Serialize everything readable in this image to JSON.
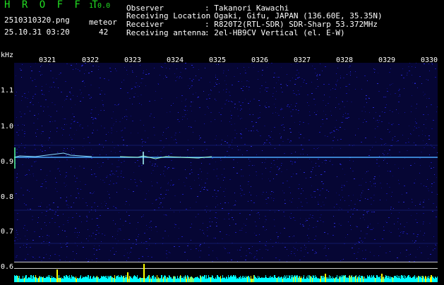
{
  "header": {
    "logo": "H R O F F T",
    "version": "1.0.0",
    "filename": "2510310320.png",
    "datetime": "25.10.31 03:20",
    "meteor_label": "meteor",
    "meteor_count": "42"
  },
  "info": {
    "observer_label": "Observer",
    "observer_value": ": Takanori Kawachi",
    "location_label": "Receiving Location",
    "location_value": ": Ogaki, Gifu, JAPAN (136.60E, 35.35N)",
    "receiver_label": "Receiver",
    "receiver_value": ": R820T2(RTL-SDR) SDR-Sharp 53.372MHz",
    "antenna_label": "Receiving antenna",
    "antenna_value": ": 2el-HB9CV Vertical (el. E-W)"
  },
  "axis": {
    "y_unit": "kHz",
    "time_ticks": [
      "0321",
      "0322",
      "0323",
      "0324",
      "0325",
      "0326",
      "0327",
      "0328",
      "0329",
      "0330"
    ],
    "freq_ticks": [
      "1.1",
      "1.0",
      "0.9",
      "0.8",
      "0.7",
      "0.6"
    ]
  },
  "colors": {
    "label_green": "#22dd22",
    "background_noise": "#0a0a50",
    "signal_line": "#66ccff",
    "bottom_bar": "#00ffff",
    "meteor_spike": "#ffff00"
  }
}
